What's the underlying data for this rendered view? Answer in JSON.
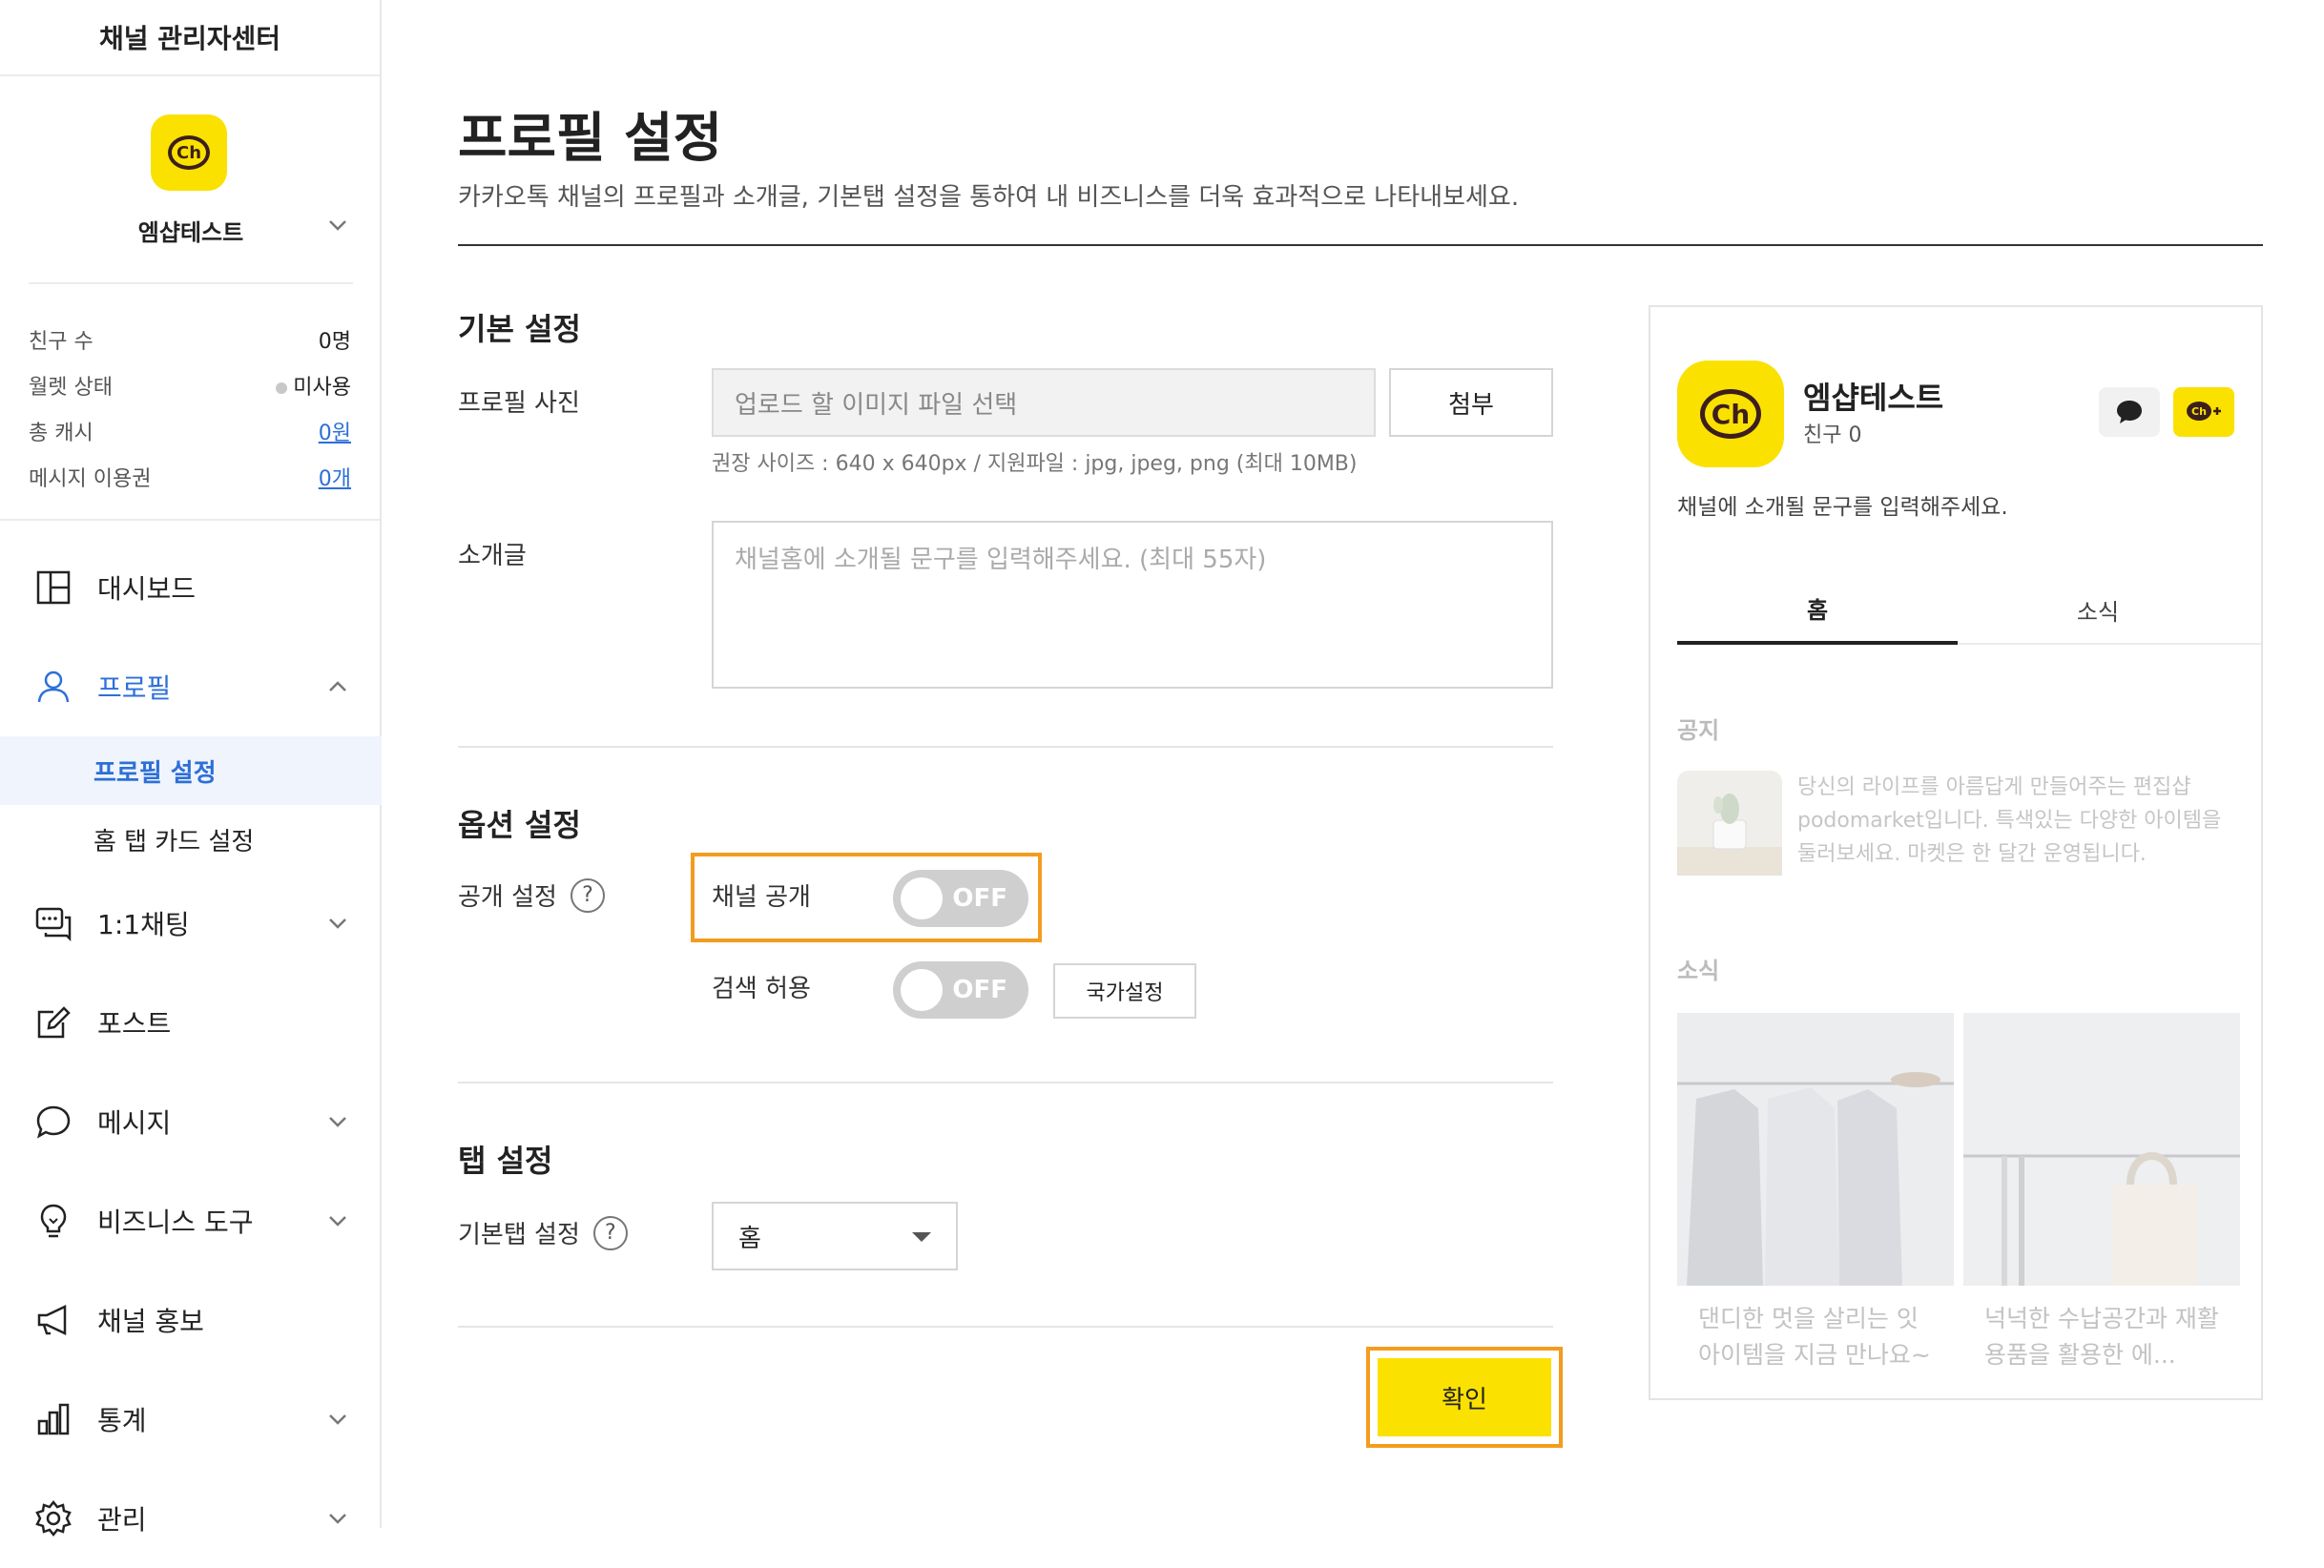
{
  "sidebar": {
    "title": "채널 관리자센터",
    "channel_logo_text": "Ch",
    "channel_name": "엠샵테스트",
    "stats": [
      {
        "label": "친구 수",
        "value": "0명"
      },
      {
        "label": "월렛 상태",
        "value": "미사용"
      },
      {
        "label": "총 캐시",
        "value": "0원"
      },
      {
        "label": "메시지 이용권",
        "value": "0개"
      }
    ],
    "nav": {
      "dashboard": "대시보드",
      "profile": "프로필",
      "profile_settings": "프로필 설정",
      "home_tab_card": "홈 탭 카드 설정",
      "chat": "1:1채팅",
      "post": "포스트",
      "message": "메시지",
      "business_tools": "비즈니스 도구",
      "promotion": "채널 홍보",
      "stats": "통계",
      "manage": "관리"
    }
  },
  "main": {
    "title": "프로필 설정",
    "description": "카카오톡 채널의 프로필과 소개글, 기본탭 설정을 통하여 내 비즈니스를 더욱 효과적으로 나타내보세요.",
    "basic": {
      "section_title": "기본 설정",
      "photo_label": "프로필 사진",
      "photo_placeholder": "업로드 할 이미지 파일 선택",
      "attach_label": "첨부",
      "photo_hint": "권장 사이즈 : 640 x 640px / 지원파일 : jpg, jpeg, png (최대 10MB)",
      "intro_label": "소개글",
      "intro_placeholder": "채널홈에 소개될 문구를 입력해주세요. (최대 55자)"
    },
    "options": {
      "section_title": "옵션 설정",
      "public_label": "공개 설정",
      "help_glyph": "?",
      "channel_public_label": "채널 공개",
      "channel_public_state": "OFF",
      "search_label": "검색 허용",
      "search_state": "OFF",
      "country_button": "국가설정"
    },
    "tabs": {
      "section_title": "탭 설정",
      "default_tab_label": "기본탭 설정",
      "default_tab_value": "홈"
    },
    "confirm_label": "확인"
  },
  "preview": {
    "logo_text": "Ch",
    "name": "엠샵테스트",
    "friends": "친구 0",
    "intro": "채널에 소개될 문구를 입력해주세요.",
    "tabs": [
      "홈",
      "소식"
    ],
    "notice_title": "공지",
    "notice_text": "당신의 라이프를 아름답게 만들어주는 편집샵 podomarket입니다. 특색있는 다양한 아이템을 둘러보세요. 마켓은 한 달간 운영됩니다.",
    "news_title": "소식",
    "cards": [
      {
        "caption": "댄디한 멋을 살리는 잇 아이템을 지금 만나요~"
      },
      {
        "caption": "넉넉한 수납공간과 재활용품을 활용한 에..."
      }
    ]
  },
  "colors": {
    "accent_yellow": "#fae100",
    "link_blue": "#2d6fd9",
    "highlight_orange": "#f39c1e"
  }
}
